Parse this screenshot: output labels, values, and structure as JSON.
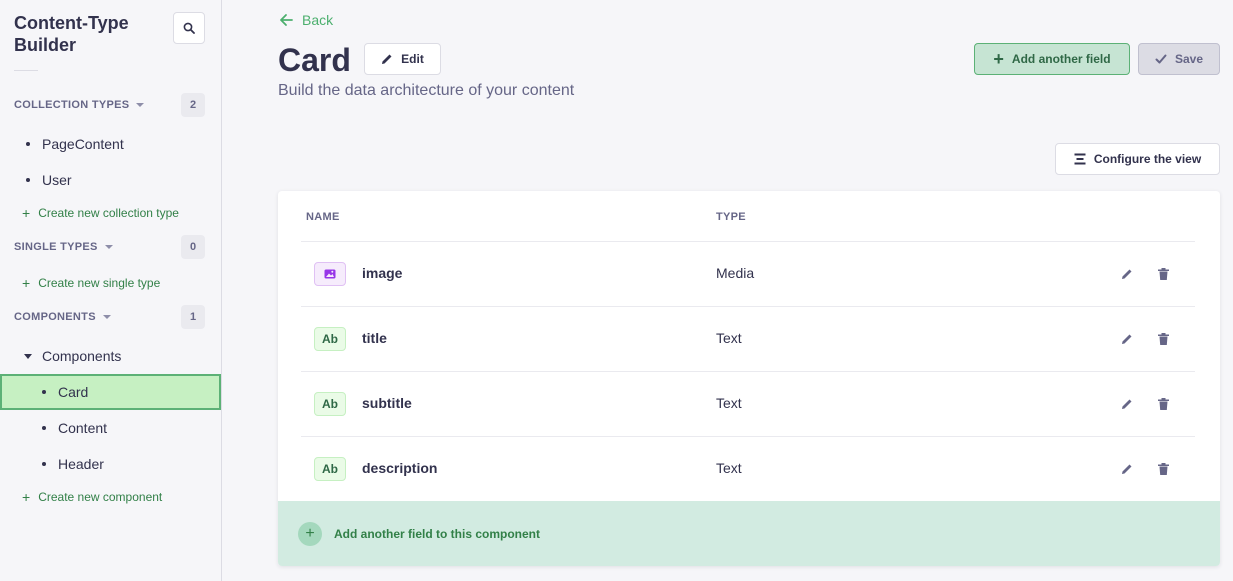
{
  "sidebar": {
    "title": "Content-Type Builder",
    "collection_types": {
      "label": "COLLECTION TYPES",
      "count": "2",
      "items": [
        "PageContent",
        "User"
      ],
      "create": "Create new collection type"
    },
    "single_types": {
      "label": "SINGLE TYPES",
      "count": "0",
      "create": "Create new single type"
    },
    "components": {
      "label": "COMPONENTS",
      "count": "1",
      "group": "Components",
      "items": [
        "Card",
        "Content",
        "Header"
      ],
      "create": "Create new component"
    }
  },
  "header": {
    "back_label": "Back",
    "title": "Card",
    "edit_label": "Edit",
    "subtitle": "Build the data architecture of your content",
    "add_field_label": "Add another field",
    "save_label": "Save",
    "configure_label": "Configure the view"
  },
  "table": {
    "columns": [
      "NAME",
      "TYPE"
    ],
    "rows": [
      {
        "icon": "image-icon",
        "badge": "",
        "name": "image",
        "type": "Media"
      },
      {
        "icon": "text-icon",
        "badge": "Ab",
        "name": "title",
        "type": "Text"
      },
      {
        "icon": "text-icon",
        "badge": "Ab",
        "name": "subtitle",
        "type": "Text"
      },
      {
        "icon": "text-icon",
        "badge": "Ab",
        "name": "description",
        "type": "Text"
      }
    ],
    "footer_add_label": "Add another field to this component"
  },
  "colors": {
    "accent_green": "#328048",
    "active_bg": "#c6f0c2",
    "media_purple": "#9736e8"
  }
}
